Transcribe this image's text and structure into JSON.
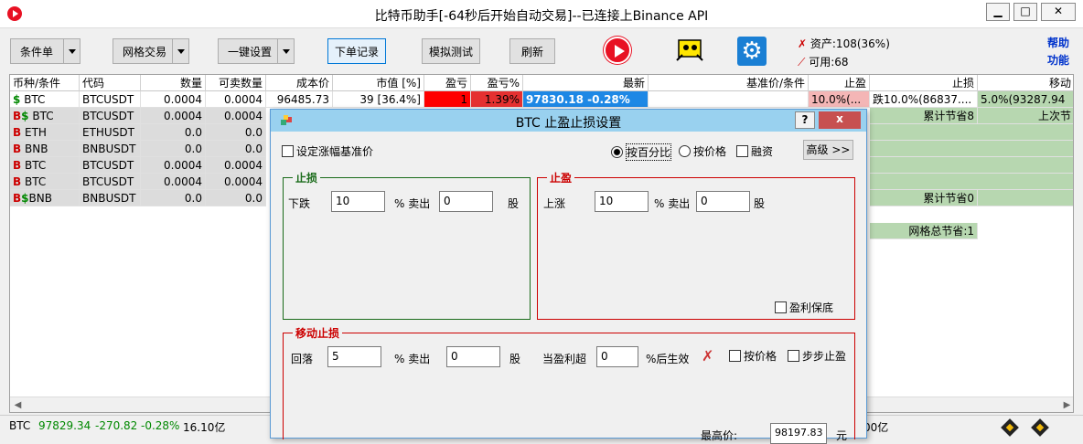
{
  "window": {
    "title": "比特币助手[-64秒后开始自动交易]--已连接上Binance API",
    "min": "▁",
    "max": "□",
    "close": "✕"
  },
  "toolbar": {
    "condition": "条件单",
    "grid": "网格交易",
    "onekey": "一键设置",
    "orders": "下单记录",
    "sim": "模拟测试",
    "refresh": "刷新"
  },
  "assets": {
    "total": "资产:108(36%)",
    "available": "可用:68"
  },
  "help": {
    "help": "帮助",
    "func": "功能"
  },
  "table": {
    "headers": [
      "币种/条件",
      "代码",
      "数量",
      "可卖数量",
      "成本价",
      "市值 [%]",
      "盈亏",
      "盈亏%",
      "最新",
      "基准价/条件",
      "止盈",
      "止损",
      "移动"
    ],
    "rows": [
      {
        "coin": "BTC",
        "code": "BTCUSDT",
        "qty": "0.0004",
        "sellable": "0.0004",
        "cost": "96485.73",
        "value": "39 [36.4%]",
        "pl": "1",
        "plp": "1.39%",
        "last": "97830.18  -0.28%",
        "tp": "10.0%(...",
        "sl": "跌10.0%(86837....",
        "mv": "5.0%(93287.94"
      },
      {
        "coin": "BTC",
        "code": "BTCUSDT",
        "qty": "0.0004",
        "sellable": "0.0004",
        "sl": "累计节省8",
        "mv": "上次节"
      },
      {
        "coin": "ETH",
        "code": "ETHUSDT",
        "qty": "0.0",
        "sellable": "0.0"
      },
      {
        "coin": "BNB",
        "code": "BNBUSDT",
        "qty": "0.0",
        "sellable": "0.0"
      },
      {
        "coin": "BTC",
        "code": "BTCUSDT",
        "qty": "0.0004",
        "sellable": "0.0004"
      },
      {
        "coin": "BTC",
        "code": "BTCUSDT",
        "qty": "0.0004",
        "sellable": "0.0004"
      },
      {
        "coin": "BNB",
        "code": "BNBUSDT",
        "qty": "0.0",
        "sellable": "0.0",
        "sl": "累计节省0"
      }
    ],
    "grid_note": "网格总节省:1"
  },
  "status": {
    "sym": "BTC",
    "price": "97829.34",
    "chg": "-270.82",
    "pct": "-0.28%",
    "vol": "16.10亿",
    "vol2": "00亿"
  },
  "dialog": {
    "title": "BTC 止盈止损设置",
    "help": "?",
    "close": "x",
    "base_check": "设定涨幅基准价",
    "by_pct": "按百分比",
    "by_price": "按价格",
    "margin": "融资",
    "advanced": "高级 >>",
    "sl": {
      "title": "止损",
      "drop": "下跌",
      "drop_val": "10",
      "sell": "% 卖出",
      "sell_val": "0",
      "unit": "股"
    },
    "tp": {
      "title": "止盈",
      "rise": "上涨",
      "rise_val": "10",
      "sell": "% 卖出",
      "sell_val": "0",
      "unit": "股",
      "protect": "盈利保底"
    },
    "trail": {
      "title": "移动止损",
      "back": "回落",
      "back_val": "5",
      "sell": "% 卖出",
      "sell_val": "0",
      "unit": "股",
      "profit_over": "当盈利超",
      "profit_val": "0",
      "effect": "%后生效",
      "by_price": "按价格",
      "step": "步步止盈",
      "max_price": "最高价:",
      "max_val": "98197.83",
      "yuan": "元"
    }
  }
}
